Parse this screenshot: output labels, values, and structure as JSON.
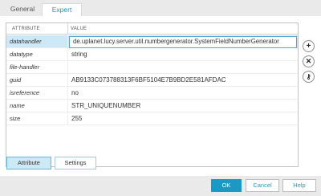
{
  "tabs": [
    {
      "label": "General",
      "active": false
    },
    {
      "label": "Expert",
      "active": true
    }
  ],
  "grid": {
    "columns": [
      "ATTRIBUTE",
      "VALUE"
    ],
    "rows": [
      {
        "name": "datahandler",
        "value": "de.uplanet.lucy.server.util.numbergenerator.SystemFieldNumberGenerator",
        "italic": true,
        "selected": true
      },
      {
        "name": "datatype",
        "value": "string",
        "italic": true
      },
      {
        "name": "file-handler",
        "value": "",
        "italic": true
      },
      {
        "name": "guid",
        "value": "AB9133C073788313F6BF5104E7B9BD2E581AFDAC",
        "italic": true
      },
      {
        "name": "isreference",
        "value": "no",
        "italic": true
      },
      {
        "name": "name",
        "value": "STR_UNIQUENUMBER",
        "italic": true
      },
      {
        "name": "size",
        "value": "255",
        "italic": false
      }
    ]
  },
  "side_actions": [
    {
      "icon": "plus-icon",
      "glyph": "+"
    },
    {
      "icon": "close-icon",
      "glyph": "✕"
    },
    {
      "icon": "key-icon",
      "glyph": "⚷"
    }
  ],
  "sub_buttons": {
    "attribute": "Attribute",
    "settings": "Settings"
  },
  "footer": {
    "ok": "OK",
    "cancel": "Cancel",
    "help": "Help"
  },
  "colors": {
    "accent": "#1c98c6",
    "selection": "#cde8f6"
  }
}
